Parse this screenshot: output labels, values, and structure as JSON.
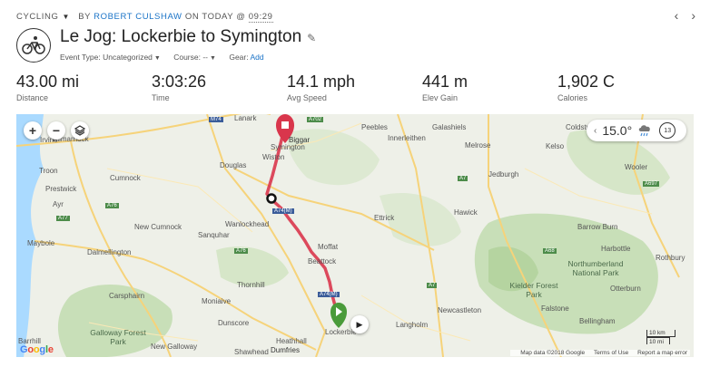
{
  "header": {
    "activity_type": "CYCLING",
    "by_label": "BY",
    "author": "ROBERT CULSHAW",
    "date_prefix": "ON TODAY @",
    "time": "09:29",
    "title": "Le Jog: Lockerbie to Symington",
    "event_type_label": "Event Type: Uncategorized",
    "course_label": "Course: --",
    "gear_label": "Gear:",
    "gear_add": "Add"
  },
  "stats": [
    {
      "value": "43.00 mi",
      "label": "Distance"
    },
    {
      "value": "3:03:26",
      "label": "Time"
    },
    {
      "value": "14.1 mph",
      "label": "Avg Speed"
    },
    {
      "value": "441 m",
      "label": "Elev Gain"
    },
    {
      "value": "1,902 C",
      "label": "Calories"
    }
  ],
  "weather": {
    "temperature": "15.0°",
    "wind": "13"
  },
  "map": {
    "towns": {
      "lanark": "Lanark",
      "biggar": "Biggar",
      "symington": "Symington",
      "wiston": "Wiston",
      "peebles": "Peebles",
      "innerleithen": "Innerleithen",
      "galashiels": "Galashiels",
      "melrose": "Melrose",
      "kelso": "Kelso",
      "coldstream": "Coldstream",
      "wooler": "Wooler",
      "jedburgh": "Jedburgh",
      "hawick": "Hawick",
      "ettrick": "Ettrick",
      "moffat": "Moffat",
      "beattock": "Beattock",
      "lockerbie": "Lockerbie",
      "dumfries": "Dumfries",
      "thornhill": "Thornhill",
      "sanquhar": "Sanquhar",
      "wanlockhead": "Wanlockhead",
      "douglas": "Douglas",
      "new_cumnock": "New Cumnock",
      "cumnock": "Cumnock",
      "dalmellington": "Dalmellington",
      "carsphairn": "Carsphairn",
      "moniaive": "Moniaive",
      "dunscore": "Dunscore",
      "new_galloway": "New Galloway",
      "shawhead": "Shawhead",
      "heathhall": "Heathhall",
      "langholm": "Langholm",
      "newcastleton": "Newcastleton",
      "kielder": "Kielder Forest Park",
      "northumberland": "Northumberland National Park",
      "galloway": "Galloway Forest Park",
      "ayr": "Ayr",
      "troon": "Troon",
      "prestwick": "Prestwick",
      "irvine": "Irvine",
      "kilmarnock": "Kilmarnock",
      "maybole": "Maybole",
      "barrow_burn": "Barrow Burn",
      "harbottle": "Harbottle",
      "rothbury": "Rothbury",
      "otterburn": "Otterburn",
      "falstone": "Falstone",
      "bellingham": "Bellingham",
      "barrhill": "Barrhill"
    },
    "roads": {
      "m74": "M74",
      "a702": "A702",
      "a7": "A7",
      "a74m": "A74(M)",
      "a76": "A76",
      "a70": "A70",
      "a77": "A77",
      "a713": "A713",
      "a697": "A697",
      "a68": "A68"
    },
    "scale_km": "10 km",
    "scale_mi": "10 mi",
    "attribution": "Map data ©2018 Google",
    "terms": "Terms of Use",
    "report": "Report a map error",
    "google_letters": [
      "G",
      "o",
      "o",
      "g",
      "l",
      "e"
    ]
  }
}
